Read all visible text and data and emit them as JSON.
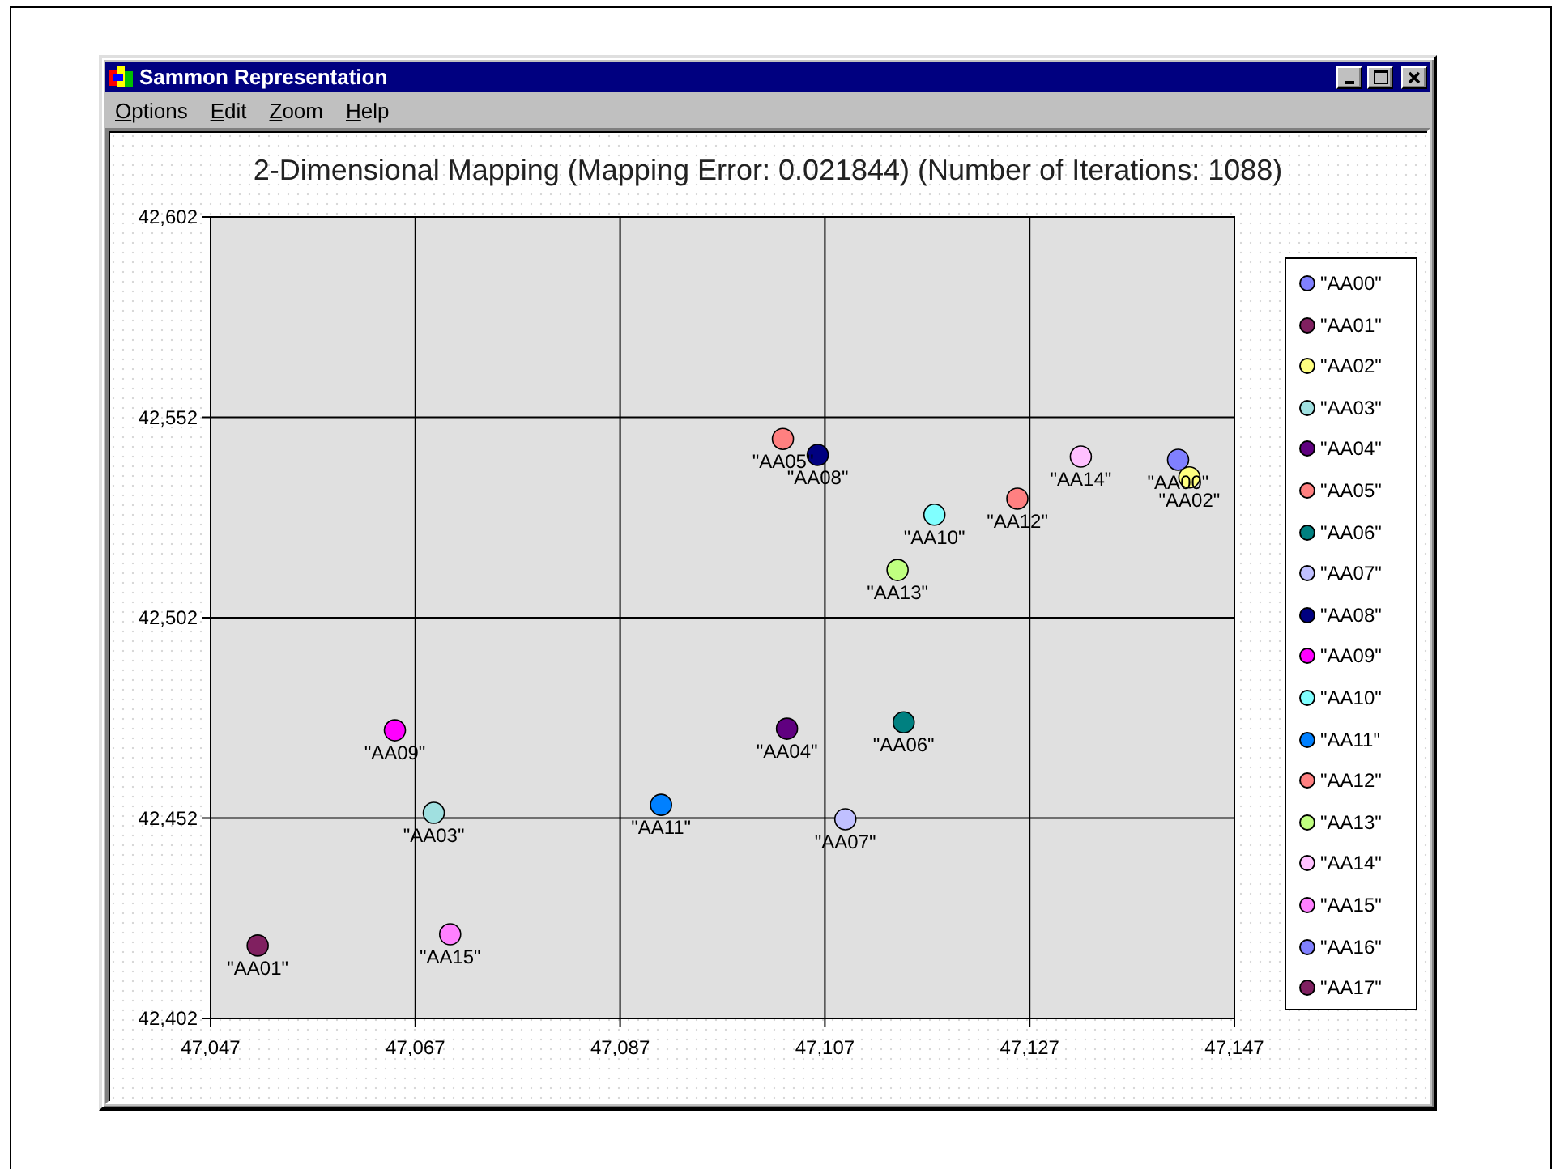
{
  "window": {
    "title": "Sammon Representation"
  },
  "menu": [
    {
      "label": "Options"
    },
    {
      "label": "Edit"
    },
    {
      "label": "Zoom"
    },
    {
      "label": "Help"
    }
  ],
  "chart": {
    "chart_data": {
      "type": "scatter",
      "title": "2-Dimensional Mapping (Mapping Error: 0.021844) (Number of Iterations: 1088)",
      "xlim": [
        47047,
        47147
      ],
      "ylim": [
        42402,
        42602
      ],
      "xticks": [
        {
          "value": 47047,
          "label": "47,047"
        },
        {
          "value": 47067,
          "label": "47,067"
        },
        {
          "value": 47087,
          "label": "47,087"
        },
        {
          "value": 47107,
          "label": "47,107"
        },
        {
          "value": 47127,
          "label": "47,127"
        },
        {
          "value": 47147,
          "label": "47,147"
        }
      ],
      "yticks": [
        {
          "value": 42402,
          "label": "42,402"
        },
        {
          "value": 42452,
          "label": "42,452"
        },
        {
          "value": 42502,
          "label": "42,502"
        },
        {
          "value": 42552,
          "label": "42,552"
        },
        {
          "value": 42602,
          "label": "42,602"
        }
      ],
      "grid": true,
      "legend": "right",
      "series": [
        {
          "name": "\"AA00\"",
          "color": "#8080ff",
          "x": [
            47141.5
          ],
          "values": [
            42541.4
          ]
        },
        {
          "name": "\"AA01\"",
          "color": "#802060",
          "x": [
            47051.6
          ],
          "values": [
            42420.2
          ]
        },
        {
          "name": "\"AA02\"",
          "color": "#ffff80",
          "x": [
            47142.6
          ],
          "values": [
            42537.0
          ]
        },
        {
          "name": "\"AA03\"",
          "color": "#a0e0e0",
          "x": [
            47068.8
          ],
          "values": [
            42453.3
          ]
        },
        {
          "name": "\"AA04\"",
          "color": "#600080",
          "x": [
            47103.3
          ],
          "values": [
            42474.3
          ]
        },
        {
          "name": "\"AA05\"",
          "color": "#ff8080",
          "x": [
            47102.9
          ],
          "values": [
            42546.6
          ]
        },
        {
          "name": "\"AA06\"",
          "color": "#008080",
          "x": [
            47114.7
          ],
          "values": [
            42475.9
          ]
        },
        {
          "name": "\"AA07\"",
          "color": "#c0c0ff",
          "x": [
            47109.0
          ],
          "values": [
            42451.7
          ]
        },
        {
          "name": "\"AA08\"",
          "color": "#000080",
          "x": [
            47106.3
          ],
          "values": [
            42542.6
          ]
        },
        {
          "name": "\"AA09\"",
          "color": "#ff00ff",
          "x": [
            47065.0
          ],
          "values": [
            42473.9
          ]
        },
        {
          "name": "\"AA10\"",
          "color": "#80ffff",
          "x": [
            47117.7
          ],
          "values": [
            42527.7
          ]
        },
        {
          "name": "\"AA11\"",
          "color": "#0080ff",
          "x": [
            47091.0
          ],
          "values": [
            42455.3
          ]
        },
        {
          "name": "\"AA12\"",
          "color": "#ff8081",
          "x": [
            47125.8
          ],
          "values": [
            42531.7
          ]
        },
        {
          "name": "\"AA13\"",
          "color": "#c0ff80",
          "x": [
            47114.1
          ],
          "values": [
            42513.9
          ]
        },
        {
          "name": "\"AA14\"",
          "color": "#ffc0ff",
          "x": [
            47132.0
          ],
          "values": [
            42542.2
          ]
        },
        {
          "name": "\"AA15\"",
          "color": "#ff80ff",
          "x": [
            47070.4
          ],
          "values": [
            42423.0
          ]
        },
        {
          "name": "\"AA16\"",
          "color": "#8080fe"
        },
        {
          "name": "\"AA17\"",
          "color": "#802061"
        }
      ]
    }
  }
}
